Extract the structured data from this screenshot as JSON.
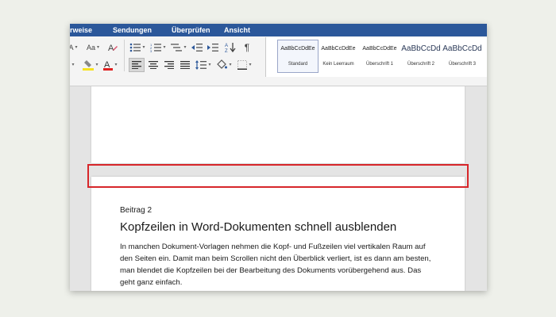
{
  "ribbon_tabs": [
    "rweise",
    "Sendungen",
    "Überprüfen",
    "Ansicht"
  ],
  "ribbon": {
    "font_size_shrink_icon": "A▾",
    "font_a_icon": "A",
    "pilcrow": "¶",
    "sort_icon": "↓"
  },
  "styles": [
    {
      "sample": "AaBbCcDdEe",
      "name": "Standard"
    },
    {
      "sample": "AaBbCcDdEe",
      "name": "Kein Leerraum"
    },
    {
      "sample": "AaBbCcDdEe",
      "name": "Überschrift 1"
    },
    {
      "sample": "AaBbCcDd",
      "name": "Überschrift 2"
    },
    {
      "sample": "AaBbCcDd",
      "name": "Überschrift 3"
    }
  ],
  "document": {
    "label": "Beitrag 2",
    "heading": "Kopfzeilen in Word-Dokumenten schnell ausblenden",
    "lines": [
      "In manchen Dokument-Vorlagen nehmen die Kopf- und Fußzeilen viel vertikalen Raum auf",
      "den Seiten ein. Damit man beim Scrollen nicht den Überblick verliert, ist es dann am besten,",
      "man blendet die Kopfzeilen bei der Bearbeitung des Dokuments vorübergehend aus. Das",
      "geht ganz einfach."
    ]
  },
  "colors": {
    "ribbon_tab_bar": "#2b579a",
    "highlight": "#d7262a",
    "highlighter_yellow": "#f6e21f",
    "font_color_red": "#e02020"
  }
}
